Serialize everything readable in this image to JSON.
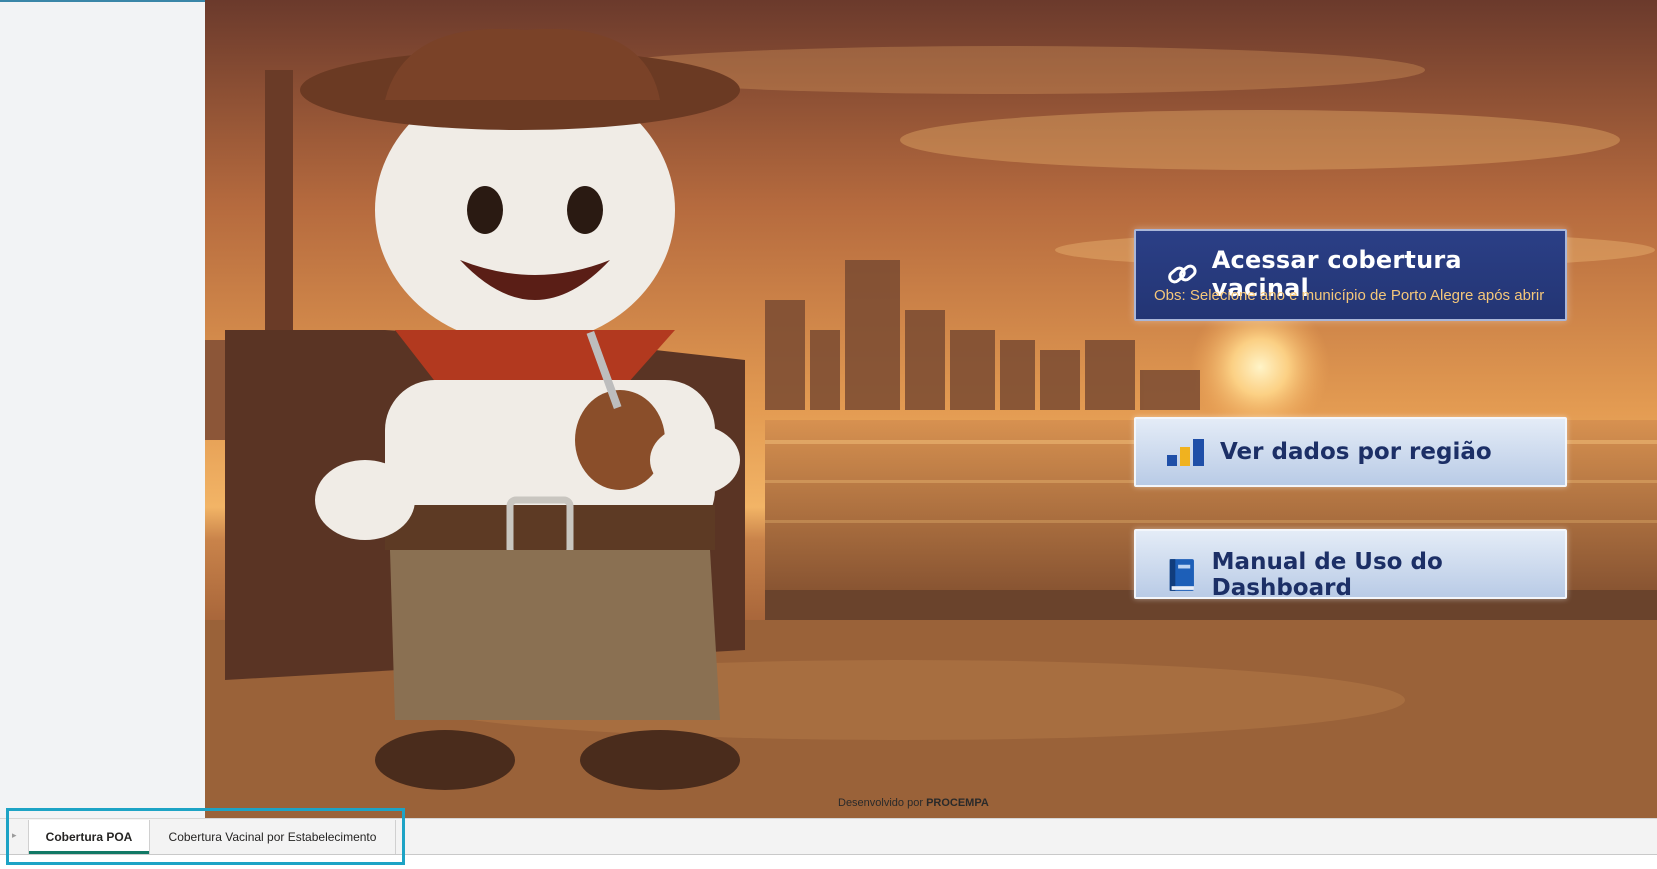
{
  "buttons": {
    "access_coverage": {
      "label": "Acessar cobertura vacinal",
      "note": "Obs: Selecione ano e município de Porto Alegre após abrir",
      "icon": "link-icon"
    },
    "region_data": {
      "label": "Ver dados por região",
      "icon": "bar-chart-icon"
    },
    "manual": {
      "label": "Manual de Uso do Dashboard",
      "icon": "book-icon"
    }
  },
  "footer": {
    "credit_prefix": "Desenvolvido por",
    "credit_org": "PROCEMPA"
  },
  "tabs": [
    {
      "label": "Cobertura POA",
      "active": true
    },
    {
      "label": "Cobertura Vacinal por Estabelecimento",
      "active": false
    }
  ],
  "colors": {
    "primary_button": "#2b3f86",
    "light_button": "#c9d8ee",
    "active_tab_underline": "#117865",
    "highlight_border": "#1da3c5"
  }
}
